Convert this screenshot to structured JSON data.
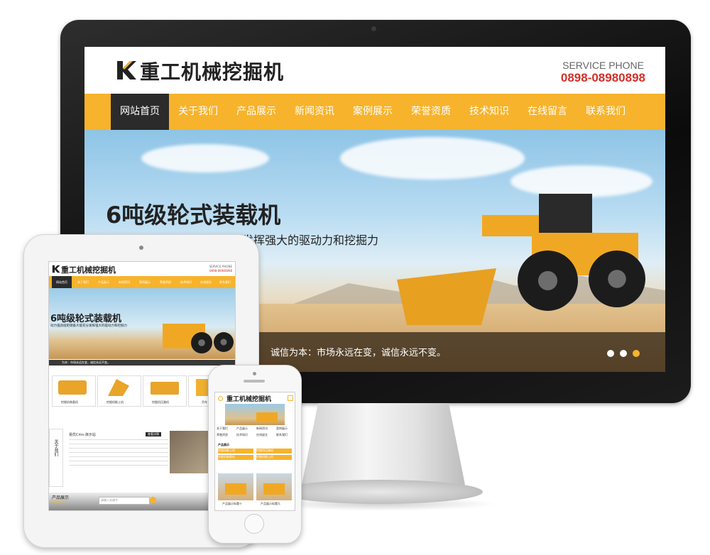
{
  "site": {
    "logo_text": "重工机械挖掘机",
    "phone_label": "SERVICE PHONE",
    "phone_number": "0898-08980898"
  },
  "nav": [
    {
      "label": "网站首页",
      "active": true
    },
    {
      "label": "关于我们",
      "active": false
    },
    {
      "label": "产品展示",
      "active": false
    },
    {
      "label": "新闻资讯",
      "active": false
    },
    {
      "label": "案例展示",
      "active": false
    },
    {
      "label": "荣誉资质",
      "active": false
    },
    {
      "label": "技术知识",
      "active": false
    },
    {
      "label": "在线留言",
      "active": false
    },
    {
      "label": "联系我们",
      "active": false
    }
  ],
  "banner": {
    "headline": "6吨级轮式装载机",
    "subline": "动力强劲扭矩储备大能充分发挥强大的驱动力和挖掘力",
    "slogan": "诚信为本：市场永远在变，诚信永远不变。",
    "slide_count": 3,
    "active_slide": 3
  },
  "tablet": {
    "phone_label": "SERVICE PHONE",
    "phone_number": "0898-08980898",
    "notice": "为本：市场永远在变，诚信永远不变。",
    "products": [
      "挖掘机装载机",
      "挖掘机推土机",
      "挖掘机压路机",
      "吊车"
    ],
    "about_title": "关于我们",
    "about_site": "易优Cms-演示站",
    "more_label": "查看详情",
    "search_placeholder": "请输入关键字",
    "section_title": "产品展示",
    "section_sub": "PRODUCT"
  },
  "phone": {
    "nav_rows": [
      [
        "关于我们",
        "产品展示",
        "新闻资讯",
        "案例展示"
      ],
      [
        "荣誉资质",
        "技术知识",
        "在线留言",
        "联系我们"
      ]
    ],
    "section_title": "产品展示",
    "list": [
      "挖掘机推土机",
      "挖掘机压路机",
      "挖掘机装载机",
      "挖掘机推土机"
    ],
    "captions": [
      "产品展示标题十",
      "产品展示标题九"
    ]
  },
  "colors": {
    "accent": "#f7b32b",
    "nav_active": "#2b2b2b",
    "phone_number": "#d0302a"
  }
}
